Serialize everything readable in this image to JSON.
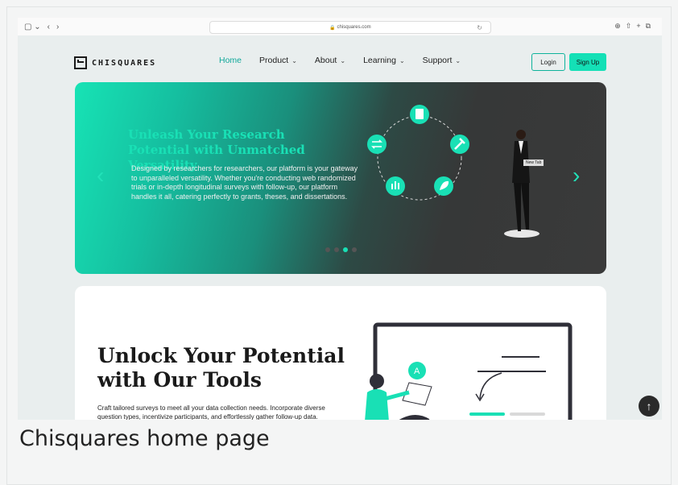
{
  "browser": {
    "url": "chisquares.com",
    "sidebar_icon": "sidebar-icon",
    "back_glyph": "‹",
    "forward_glyph": "›"
  },
  "nav": {
    "logo_text": "CHISQUARES",
    "items": [
      {
        "label": "Home",
        "active": true
      },
      {
        "label": "Product",
        "dropdown": true
      },
      {
        "label": "About",
        "dropdown": true
      },
      {
        "label": "Learning",
        "dropdown": true
      },
      {
        "label": "Support",
        "dropdown": true
      }
    ],
    "login_label": "Login",
    "signup_label": "Sign Up"
  },
  "hero": {
    "title": "Unleash Your Research Potential with Unmatched Versatility",
    "body": "Designed by researchers for researchers, our platform is your gateway to unparalleled versatility. Whether you're conducting web randomized trials or in-depth longitudinal surveys with follow-up, our platform handles it all, catering perfectly to grants, theses, and dissertations.",
    "tooltip": "New Tab",
    "slides_total": 4,
    "active_slide": 3
  },
  "tools": {
    "title": "Unlock Your Potential with Our Tools",
    "body": "Craft tailored surveys to meet all your data collection needs. Incorporate diverse question types, incentivize participants, and effortlessly gather follow-up data."
  },
  "caption": "Chisquares home page",
  "colors": {
    "accent": "#19e0b5",
    "dark": "#3a3a3a"
  }
}
